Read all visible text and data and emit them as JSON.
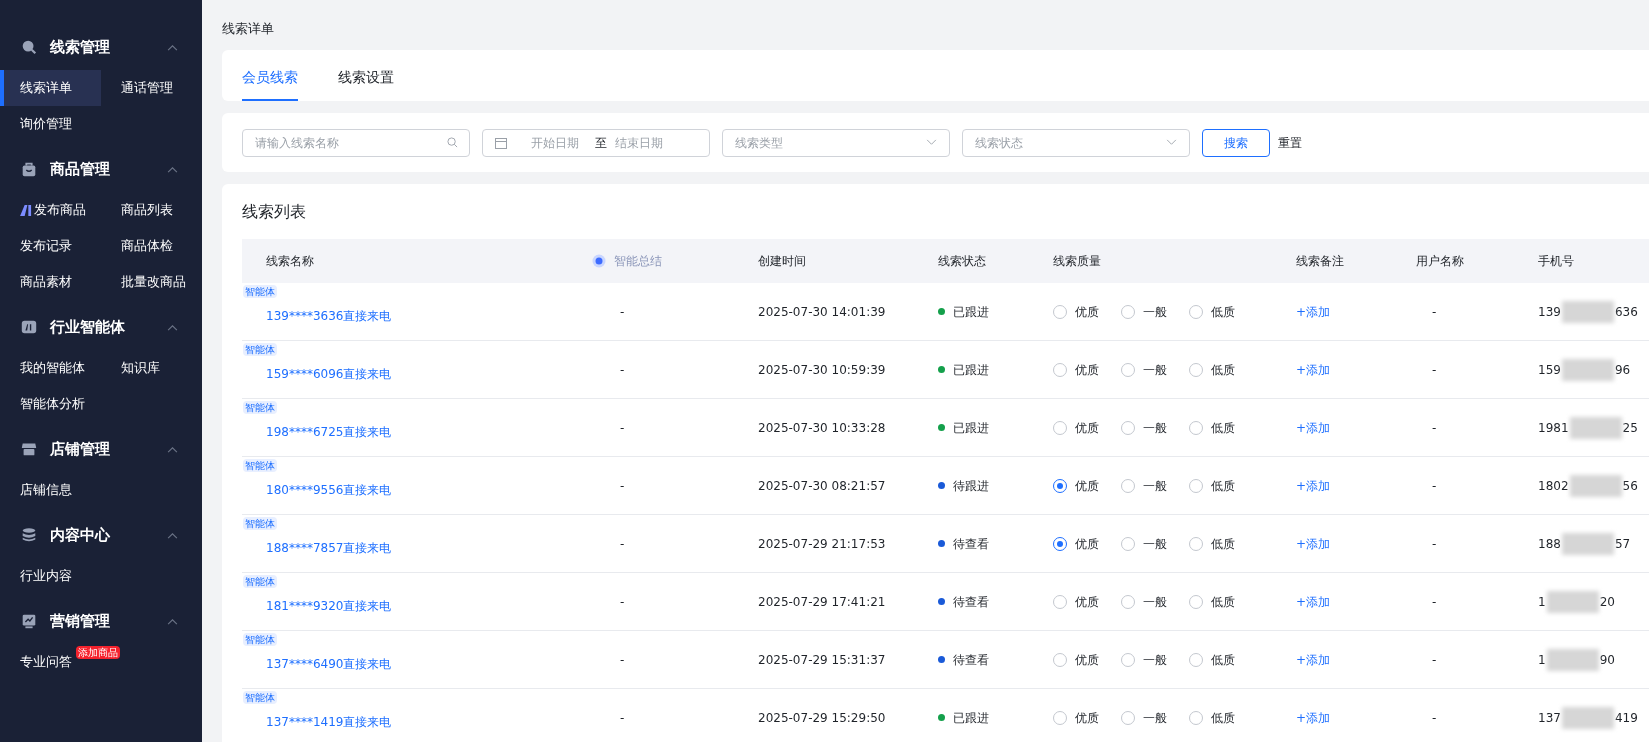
{
  "sidebar": {
    "sections": [
      {
        "kind": "search",
        "title": "线索管理",
        "expanded": true,
        "items": [
          {
            "label": "线索详单",
            "selected": true
          },
          {
            "label": "通话管理",
            "selected": false
          },
          {
            "label": "询价管理",
            "selected": false
          }
        ]
      },
      {
        "kind": "bag",
        "title": "商品管理",
        "expanded": true,
        "items": [
          {
            "label": "发布商品",
            "selected": false,
            "ai": true
          },
          {
            "label": "商品列表",
            "selected": false
          },
          {
            "label": "发布记录",
            "selected": false
          },
          {
            "label": "商品体检",
            "selected": false
          },
          {
            "label": "商品素材",
            "selected": false
          },
          {
            "label": "批量改商品",
            "selected": false
          }
        ]
      },
      {
        "kind": "ai",
        "title": "行业智能体",
        "expanded": true,
        "items": [
          {
            "label": "我的智能体",
            "selected": false
          },
          {
            "label": "知识库",
            "selected": false
          },
          {
            "label": "智能体分析",
            "selected": false
          }
        ]
      },
      {
        "kind": "store",
        "title": "店铺管理",
        "expanded": true,
        "items": [
          {
            "label": "店铺信息",
            "selected": false
          }
        ]
      },
      {
        "kind": "database",
        "title": "内容中心",
        "expanded": true,
        "items": [
          {
            "label": "行业内容",
            "selected": false
          }
        ]
      },
      {
        "kind": "chart",
        "title": "营销管理",
        "expanded": true,
        "items": [
          {
            "label": "专业问答",
            "selected": false,
            "badge": "添加商品"
          }
        ]
      }
    ]
  },
  "breadcrumb": "线索详单",
  "tabs": [
    {
      "label": "会员线索",
      "selected": true
    },
    {
      "label": "线索设置",
      "selected": false
    }
  ],
  "filters": {
    "name": {
      "placeholder": "请输入线索名称"
    },
    "date_start": {
      "placeholder": "开始日期"
    },
    "date_sep": "至",
    "date_end": {
      "placeholder": "结束日期"
    },
    "type": {
      "placeholder": "线索类型"
    },
    "status": {
      "placeholder": "线索状态"
    },
    "search_button": "搜索",
    "reset_button": "重置"
  },
  "table": {
    "title": "线索列表",
    "columns": [
      "线索名称",
      "智能总结",
      "创建时间",
      "线索状态",
      "线索质量",
      "线索备注",
      "用户名称",
      "手机号"
    ],
    "rows": [
      {
        "tag": "智能体",
        "name": "139****3636直接来电",
        "summary": "-",
        "time": "2025-07-30 14:01:39",
        "status": {
          "text": "已跟进",
          "color": "#14a04b"
        },
        "quality": [
          {
            "label": "优质",
            "selected": false
          },
          {
            "label": "一般",
            "selected": false
          },
          {
            "label": "低质",
            "selected": false
          }
        ],
        "note": "+添加",
        "user": "-",
        "phone_start": "139",
        "phone_end": "636"
      },
      {
        "tag": "智能体",
        "name": "159****6096直接来电",
        "summary": "-",
        "time": "2025-07-30 10:59:39",
        "status": {
          "text": "已跟进",
          "color": "#14a04b"
        },
        "quality": [
          {
            "label": "优质",
            "selected": false
          },
          {
            "label": "一般",
            "selected": false
          },
          {
            "label": "低质",
            "selected": false
          }
        ],
        "note": "+添加",
        "user": "-",
        "phone_start": "159",
        "phone_end": "96"
      },
      {
        "tag": "智能体",
        "name": "198****6725直接来电",
        "summary": "-",
        "time": "2025-07-30 10:33:28",
        "status": {
          "text": "已跟进",
          "color": "#14a04b"
        },
        "quality": [
          {
            "label": "优质",
            "selected": false
          },
          {
            "label": "一般",
            "selected": false
          },
          {
            "label": "低质",
            "selected": false
          }
        ],
        "note": "+添加",
        "user": "-",
        "phone_start": "1981",
        "phone_end": "25"
      },
      {
        "tag": "智能体",
        "name": "180****9556直接来电",
        "summary": "-",
        "time": "2025-07-30 08:21:57",
        "status": {
          "text": "待跟进",
          "color": "#1a5ad8"
        },
        "quality": [
          {
            "label": "优质",
            "selected": true
          },
          {
            "label": "一般",
            "selected": false
          },
          {
            "label": "低质",
            "selected": false
          }
        ],
        "note": "+添加",
        "user": "-",
        "phone_start": "1802",
        "phone_end": "56"
      },
      {
        "tag": "智能体",
        "name": "188****7857直接来电",
        "summary": "-",
        "time": "2025-07-29 21:17:53",
        "status": {
          "text": "待查看",
          "color": "#1a5ad8"
        },
        "quality": [
          {
            "label": "优质",
            "selected": true
          },
          {
            "label": "一般",
            "selected": false
          },
          {
            "label": "低质",
            "selected": false
          }
        ],
        "note": "+添加",
        "user": "-",
        "phone_start": "188",
        "phone_end": "57"
      },
      {
        "tag": "智能体",
        "name": "181****9320直接来电",
        "summary": "-",
        "time": "2025-07-29 17:41:21",
        "status": {
          "text": "待查看",
          "color": "#1a5ad8"
        },
        "quality": [
          {
            "label": "优质",
            "selected": false
          },
          {
            "label": "一般",
            "selected": false
          },
          {
            "label": "低质",
            "selected": false
          }
        ],
        "note": "+添加",
        "user": "-",
        "phone_start": "1",
        "phone_end": "20"
      },
      {
        "tag": "智能体",
        "name": "137****6490直接来电",
        "summary": "-",
        "time": "2025-07-29 15:31:37",
        "status": {
          "text": "待查看",
          "color": "#1a5ad8"
        },
        "quality": [
          {
            "label": "优质",
            "selected": false
          },
          {
            "label": "一般",
            "selected": false
          },
          {
            "label": "低质",
            "selected": false
          }
        ],
        "note": "+添加",
        "user": "-",
        "phone_start": "1",
        "phone_end": "90"
      },
      {
        "tag": "智能体",
        "name": "137****1419直接来电",
        "summary": "-",
        "time": "2025-07-29 15:29:50",
        "status": {
          "text": "已跟进",
          "color": "#14a04b"
        },
        "quality": [
          {
            "label": "优质",
            "selected": false
          },
          {
            "label": "一般",
            "selected": false
          },
          {
            "label": "低质",
            "selected": false
          }
        ],
        "note": "+添加",
        "user": "-",
        "phone_start": "137",
        "phone_end": "419"
      }
    ]
  }
}
